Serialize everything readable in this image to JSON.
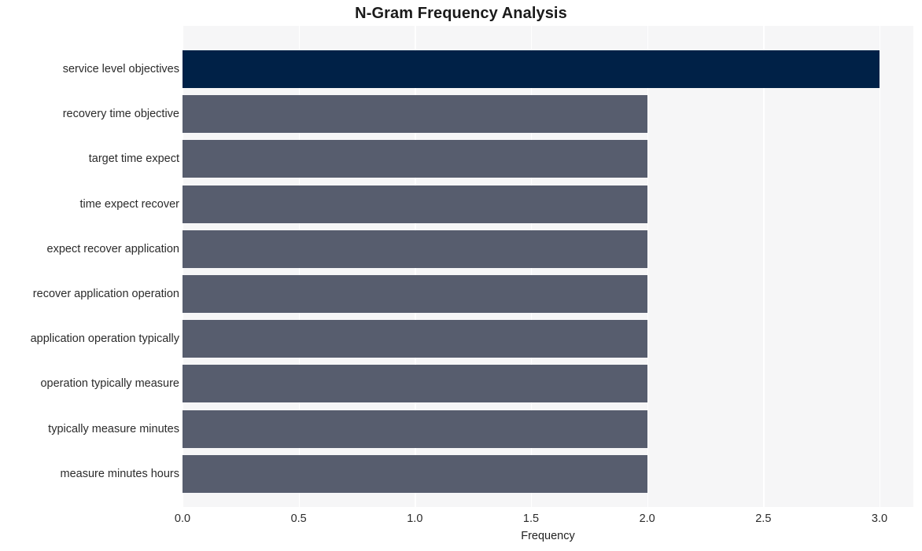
{
  "chart_data": {
    "type": "bar",
    "orientation": "horizontal",
    "title": "N-Gram Frequency Analysis",
    "xlabel": "Frequency",
    "ylabel": "",
    "xlim": [
      0,
      3.0
    ],
    "xticks": [
      "0.0",
      "0.5",
      "1.0",
      "1.5",
      "2.0",
      "2.5",
      "3.0"
    ],
    "xtick_values": [
      0.0,
      0.5,
      1.0,
      1.5,
      2.0,
      2.5,
      3.0
    ],
    "grid": true,
    "grid_axis": "x",
    "legend": "none",
    "categories": [
      "service level objectives",
      "recovery time objective",
      "target time expect",
      "time expect recover",
      "expect recover application",
      "recover application operation",
      "application operation typically",
      "operation typically measure",
      "typically measure minutes",
      "measure minutes hours"
    ],
    "values": [
      3,
      2,
      2,
      2,
      2,
      2,
      2,
      2,
      2,
      2
    ],
    "bar_colors": [
      "#002147",
      "#575d6e",
      "#575d6e",
      "#575d6e",
      "#575d6e",
      "#575d6e",
      "#575d6e",
      "#575d6e",
      "#575d6e",
      "#575d6e"
    ]
  },
  "style": {
    "plot_background": "#f6f6f7",
    "figure_background": "#ffffff",
    "gridline_color": "#ffffff",
    "highlight_color": "#002147",
    "bar_color": "#575d6e",
    "text_color": "#2b2b2b"
  }
}
